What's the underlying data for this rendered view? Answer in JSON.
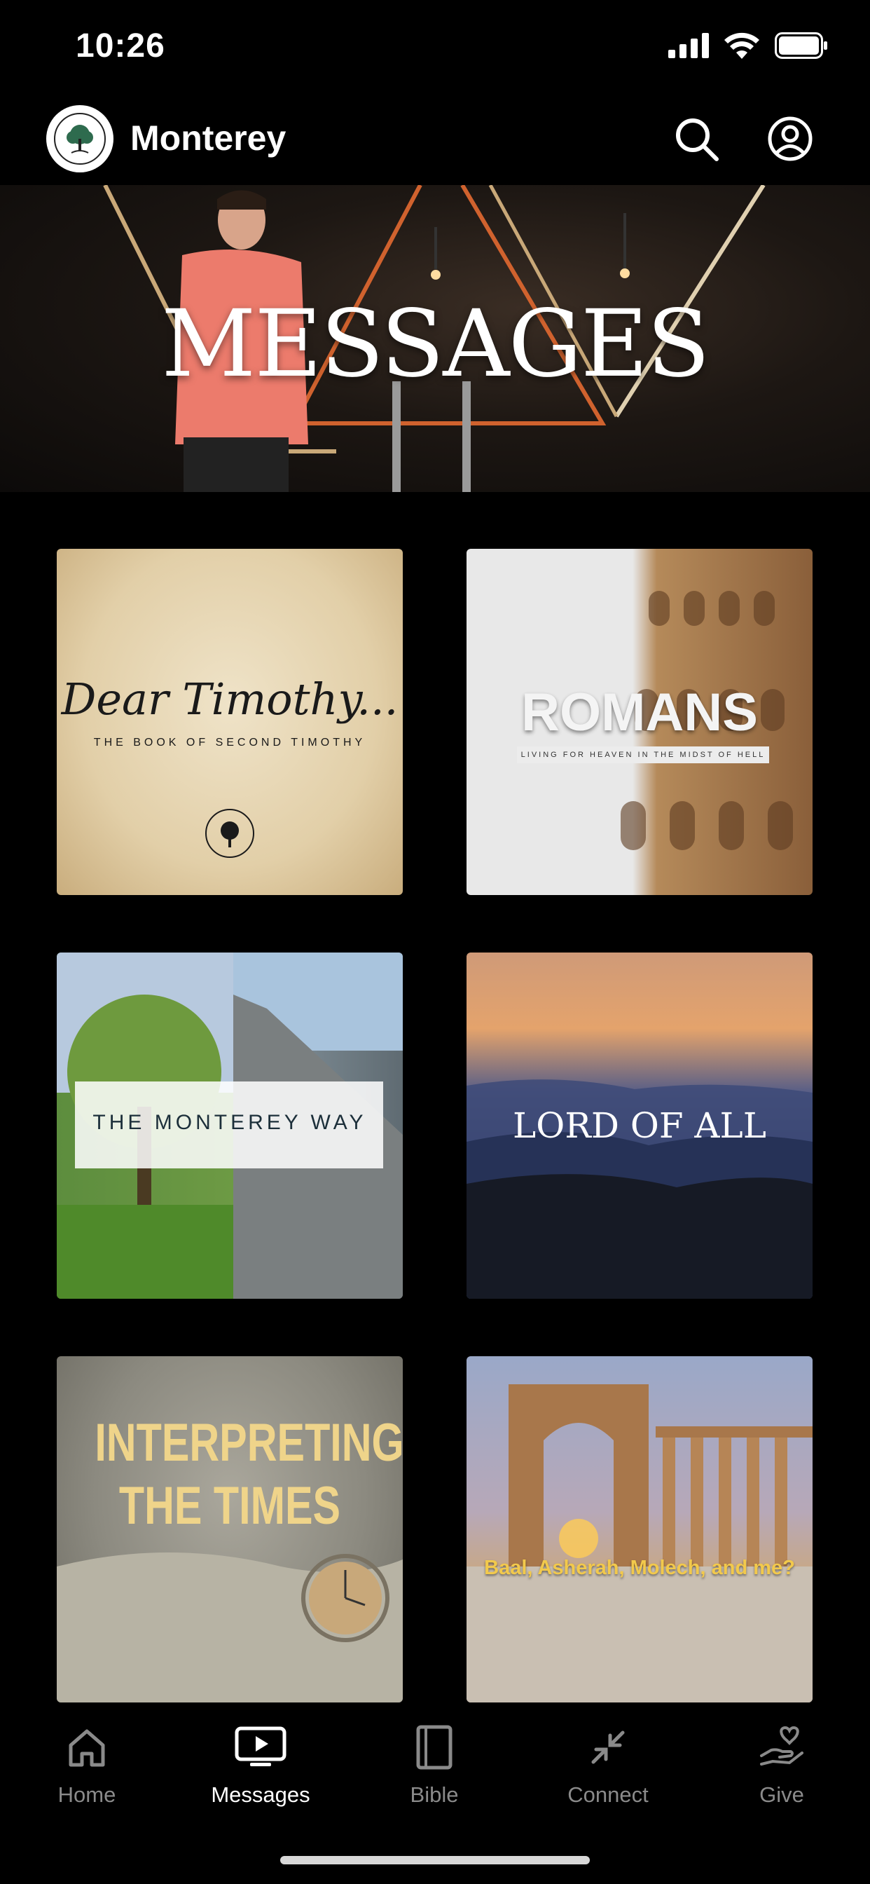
{
  "status_bar": {
    "time": "10:26"
  },
  "header": {
    "church_name": "Monterey",
    "logo_text": "MONTEREY CHURCH"
  },
  "hero": {
    "title": "MESSAGES"
  },
  "series": [
    {
      "title_script": "Dear Timothy...",
      "subtitle": "THE BOOK OF SECOND TIMOTHY",
      "badge": "MONTEREY CHURCH"
    },
    {
      "title": "ROMANS",
      "subtitle": "LIVING FOR HEAVEN IN THE MIDST OF HELL"
    },
    {
      "title": "THE MONTEREY WAY"
    },
    {
      "title": "LORD OF ALL"
    },
    {
      "title_line1": "INTERPRETING",
      "title_line2": "THE TIMES"
    },
    {
      "title": "Baal, Asherah, Molech, and me?"
    }
  ],
  "tabbar": {
    "home": "Home",
    "messages": "Messages",
    "bible": "Bible",
    "connect": "Connect",
    "give": "Give",
    "active": "Messages"
  },
  "colors": {
    "background": "#000000",
    "tab_inactive": "#8a8a8a",
    "tab_active": "#ffffff"
  }
}
